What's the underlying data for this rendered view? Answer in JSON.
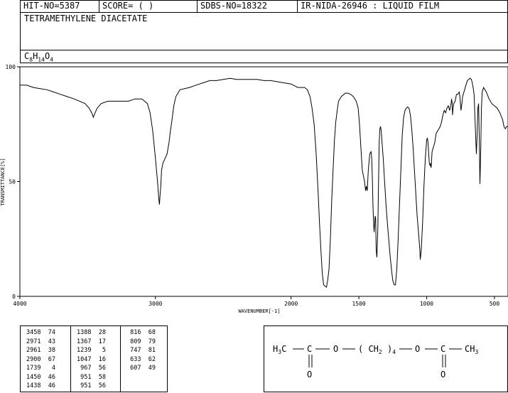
{
  "header": {
    "hit_no": "HIT-NO=5387",
    "score": "SCORE=  (   )",
    "sdbs_no": "SDBS-NO=18322",
    "ir_id": "IR-NIDA-26946 : LIQUID FILM"
  },
  "compound_name": "TETRAMETHYLENE DIACETATE",
  "formula": "C8H14O4",
  "chart_data": {
    "type": "line",
    "xlabel": "WAVENUMBER[-1]",
    "ylabel": "TRANSMITTANCE[%]",
    "xlim": [
      4000,
      400
    ],
    "ylim": [
      0,
      100
    ],
    "x_ticks": [
      "4000",
      "3000",
      "2000",
      "1500",
      "1000",
      "500"
    ],
    "y_ticks": [
      "100",
      "50",
      "0"
    ],
    "series": [
      {
        "points": [
          [
            4000,
            92
          ],
          [
            3950,
            92
          ],
          [
            3900,
            91
          ],
          [
            3850,
            90.5
          ],
          [
            3800,
            90
          ],
          [
            3750,
            89
          ],
          [
            3700,
            88
          ],
          [
            3650,
            87
          ],
          [
            3600,
            86
          ],
          [
            3560,
            85
          ],
          [
            3520,
            84
          ],
          [
            3490,
            82
          ],
          [
            3470,
            80
          ],
          [
            3458,
            78
          ],
          [
            3445,
            80
          ],
          [
            3430,
            82
          ],
          [
            3400,
            84
          ],
          [
            3350,
            85
          ],
          [
            3300,
            85
          ],
          [
            3250,
            85
          ],
          [
            3200,
            85
          ],
          [
            3150,
            86
          ],
          [
            3100,
            86
          ],
          [
            3060,
            84
          ],
          [
            3040,
            80
          ],
          [
            3020,
            72
          ],
          [
            3000,
            60
          ],
          [
            2985,
            50
          ],
          [
            2975,
            42
          ],
          [
            2971,
            40
          ],
          [
            2965,
            45
          ],
          [
            2961,
            48
          ],
          [
            2955,
            55
          ],
          [
            2945,
            58
          ],
          [
            2930,
            60
          ],
          [
            2915,
            62
          ],
          [
            2900,
            67
          ],
          [
            2890,
            72
          ],
          [
            2880,
            76
          ],
          [
            2865,
            83
          ],
          [
            2850,
            87
          ],
          [
            2820,
            90
          ],
          [
            2750,
            91
          ],
          [
            2700,
            92
          ],
          [
            2650,
            93
          ],
          [
            2600,
            94
          ],
          [
            2550,
            94
          ],
          [
            2500,
            94.5
          ],
          [
            2450,
            95
          ],
          [
            2400,
            94.5
          ],
          [
            2300,
            94.5
          ],
          [
            2250,
            94.5
          ],
          [
            2200,
            94
          ],
          [
            2150,
            94
          ],
          [
            2100,
            93.5
          ],
          [
            2050,
            93
          ],
          [
            2000,
            92.5
          ],
          [
            1950,
            91
          ],
          [
            1900,
            91
          ],
          [
            1880,
            90
          ],
          [
            1860,
            87
          ],
          [
            1845,
            82
          ],
          [
            1830,
            75
          ],
          [
            1815,
            62
          ],
          [
            1800,
            45
          ],
          [
            1790,
            32
          ],
          [
            1780,
            20
          ],
          [
            1770,
            10
          ],
          [
            1760,
            5
          ],
          [
            1750,
            4.5
          ],
          [
            1739,
            4
          ],
          [
            1730,
            7
          ],
          [
            1720,
            12
          ],
          [
            1710,
            25
          ],
          [
            1700,
            42
          ],
          [
            1690,
            55
          ],
          [
            1680,
            68
          ],
          [
            1670,
            76
          ],
          [
            1660,
            81
          ],
          [
            1650,
            85
          ],
          [
            1630,
            87
          ],
          [
            1600,
            88.5
          ],
          [
            1580,
            88.5
          ],
          [
            1560,
            88
          ],
          [
            1540,
            87
          ],
          [
            1520,
            85
          ],
          [
            1505,
            82
          ],
          [
            1495,
            75
          ],
          [
            1485,
            65
          ],
          [
            1475,
            55
          ],
          [
            1465,
            52
          ],
          [
            1458,
            50
          ],
          [
            1450,
            46
          ],
          [
            1445,
            48
          ],
          [
            1438,
            46
          ],
          [
            1430,
            55
          ],
          [
            1420,
            62
          ],
          [
            1410,
            63
          ],
          [
            1405,
            60
          ],
          [
            1400,
            50
          ],
          [
            1396,
            40
          ],
          [
            1392,
            33
          ],
          [
            1388,
            28
          ],
          [
            1385,
            30
          ],
          [
            1380,
            35
          ],
          [
            1376,
            34
          ],
          [
            1372,
            20
          ],
          [
            1367,
            17
          ],
          [
            1360,
            30
          ],
          [
            1355,
            50
          ],
          [
            1350,
            67
          ],
          [
            1345,
            73
          ],
          [
            1340,
            74
          ],
          [
            1335,
            72
          ],
          [
            1330,
            68
          ],
          [
            1320,
            60
          ],
          [
            1310,
            50
          ],
          [
            1300,
            40
          ],
          [
            1290,
            32
          ],
          [
            1280,
            25
          ],
          [
            1270,
            18
          ],
          [
            1260,
            12
          ],
          [
            1250,
            7
          ],
          [
            1245,
            6
          ],
          [
            1239,
            5
          ],
          [
            1230,
            5
          ],
          [
            1220,
            12
          ],
          [
            1210,
            25
          ],
          [
            1200,
            40
          ],
          [
            1190,
            55
          ],
          [
            1180,
            70
          ],
          [
            1170,
            78
          ],
          [
            1160,
            81
          ],
          [
            1150,
            82
          ],
          [
            1140,
            82.5
          ],
          [
            1130,
            82
          ],
          [
            1120,
            79
          ],
          [
            1110,
            73
          ],
          [
            1100,
            65
          ],
          [
            1090,
            55
          ],
          [
            1080,
            45
          ],
          [
            1070,
            35
          ],
          [
            1060,
            28
          ],
          [
            1050,
            20
          ],
          [
            1047,
            16
          ],
          [
            1040,
            20
          ],
          [
            1030,
            32
          ],
          [
            1020,
            48
          ],
          [
            1010,
            60
          ],
          [
            1000,
            68
          ],
          [
            995,
            69
          ],
          [
            990,
            67
          ],
          [
            985,
            62
          ],
          [
            980,
            58
          ],
          [
            975,
            57
          ],
          [
            970,
            58
          ],
          [
            967,
            56
          ],
          [
            963,
            60
          ],
          [
            960,
            63
          ],
          [
            955,
            64
          ],
          [
            950,
            65
          ],
          [
            940,
            67
          ],
          [
            930,
            71
          ],
          [
            920,
            72
          ],
          [
            910,
            73
          ],
          [
            900,
            74
          ],
          [
            890,
            76
          ],
          [
            880,
            79
          ],
          [
            870,
            81
          ],
          [
            860,
            80
          ],
          [
            850,
            82
          ],
          [
            840,
            83
          ],
          [
            830,
            81
          ],
          [
            820,
            84
          ],
          [
            816,
            86
          ],
          [
            812,
            84
          ],
          [
            809,
            79
          ],
          [
            805,
            82
          ],
          [
            800,
            84
          ],
          [
            790,
            85
          ],
          [
            780,
            88
          ],
          [
            770,
            88
          ],
          [
            760,
            89
          ],
          [
            755,
            87
          ],
          [
            747,
            81
          ],
          [
            740,
            84
          ],
          [
            735,
            87
          ],
          [
            720,
            90
          ],
          [
            710,
            92
          ],
          [
            700,
            94
          ],
          [
            690,
            94.5
          ],
          [
            680,
            95
          ],
          [
            670,
            94.5
          ],
          [
            660,
            92
          ],
          [
            650,
            88
          ],
          [
            645,
            80
          ],
          [
            640,
            72
          ],
          [
            637,
            67
          ],
          [
            633,
            62
          ],
          [
            628,
            70
          ],
          [
            622,
            82
          ],
          [
            617,
            84
          ],
          [
            612,
            70
          ],
          [
            607,
            49
          ],
          [
            602,
            62
          ],
          [
            596,
            82
          ],
          [
            590,
            89
          ],
          [
            580,
            91
          ],
          [
            570,
            90
          ],
          [
            560,
            89
          ],
          [
            540,
            86
          ],
          [
            520,
            84
          ],
          [
            500,
            83
          ],
          [
            480,
            82
          ],
          [
            460,
            80
          ],
          [
            440,
            77
          ],
          [
            430,
            74
          ],
          [
            420,
            73
          ],
          [
            410,
            74
          ],
          [
            400,
            74
          ]
        ]
      }
    ]
  },
  "peak_table": {
    "columns": [
      [
        [
          "3458",
          "74"
        ],
        [
          "2971",
          "43"
        ],
        [
          "2961",
          "38"
        ],
        [
          "2900",
          "67"
        ],
        [
          "1739",
          "4"
        ],
        [
          "1450",
          "46"
        ],
        [
          "1438",
          "46"
        ]
      ],
      [
        [
          "1388",
          "28"
        ],
        [
          "1367",
          "17"
        ],
        [
          "1239",
          "5"
        ],
        [
          "1047",
          "16"
        ],
        [
          "967",
          "56"
        ],
        [
          "951",
          "58"
        ],
        [
          "951",
          "56"
        ]
      ],
      [
        [
          "816",
          "68"
        ],
        [
          "809",
          "79"
        ],
        [
          "747",
          "81"
        ],
        [
          "633",
          "62"
        ],
        [
          "607",
          "49"
        ]
      ]
    ]
  },
  "structure": {
    "left_methyl": "H3C",
    "carbon_left": "C",
    "ester_o_left": "O",
    "chain": "(CH2)4",
    "ester_o_right": "O",
    "carbon_right": "C",
    "right_methyl": "CH3",
    "carbonyl_o": "O"
  }
}
